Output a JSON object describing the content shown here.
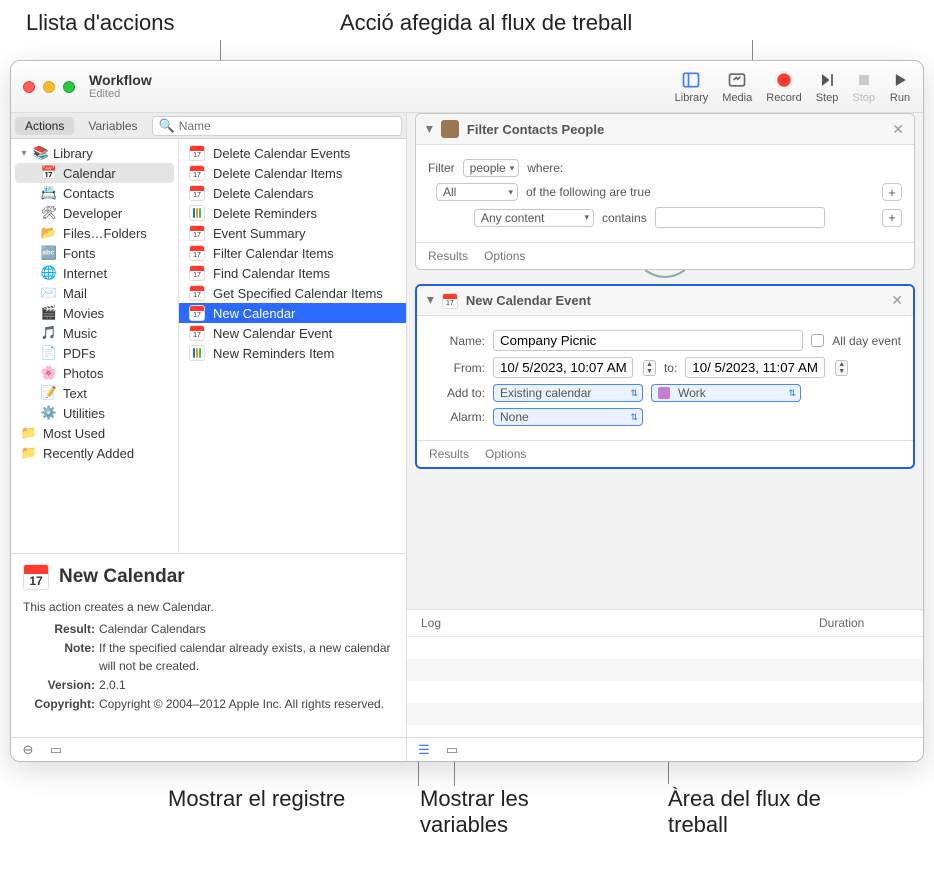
{
  "callouts": {
    "actions_list": "Llista d'accions",
    "added_action": "Acció afegida al flux de treball",
    "show_log": "Mostrar el registre",
    "show_vars": "Mostrar les variables",
    "workflow_area": "Àrea del flux de treball"
  },
  "window": {
    "title": "Workflow",
    "subtitle": "Edited"
  },
  "toolbar": {
    "library": "Library",
    "media": "Media",
    "record": "Record",
    "step": "Step",
    "stop": "Stop",
    "run": "Run"
  },
  "tabs": {
    "actions": "Actions",
    "variables": "Variables"
  },
  "search": {
    "placeholder": "Name"
  },
  "libraryHeader": "Library",
  "categories": [
    {
      "label": "Calendar",
      "sel": true
    },
    {
      "label": "Contacts"
    },
    {
      "label": "Developer"
    },
    {
      "label": "Files…Folders"
    },
    {
      "label": "Fonts"
    },
    {
      "label": "Internet"
    },
    {
      "label": "Mail"
    },
    {
      "label": "Movies"
    },
    {
      "label": "Music"
    },
    {
      "label": "PDFs"
    },
    {
      "label": "Photos"
    },
    {
      "label": "Text"
    },
    {
      "label": "Utilities"
    }
  ],
  "metaCats": [
    "Most Used",
    "Recently Added"
  ],
  "actions": [
    {
      "label": "Delete Calendar Events",
      "icon": "cal"
    },
    {
      "label": "Delete Calendar Items",
      "icon": "cal"
    },
    {
      "label": "Delete Calendars",
      "icon": "cal"
    },
    {
      "label": "Delete Reminders",
      "icon": "rem"
    },
    {
      "label": "Event Summary",
      "icon": "cal"
    },
    {
      "label": "Filter Calendar Items",
      "icon": "cal"
    },
    {
      "label": "Find Calendar Items",
      "icon": "cal"
    },
    {
      "label": "Get Specified Calendar Items",
      "icon": "cal"
    },
    {
      "label": "New Calendar",
      "icon": "cal",
      "sel": true
    },
    {
      "label": "New Calendar Event",
      "icon": "cal"
    },
    {
      "label": "New Reminders Item",
      "icon": "rem"
    }
  ],
  "desc": {
    "title": "New Calendar",
    "body": "This action creates a new Calendar.",
    "resultLabel": "Result:",
    "result": "Calendar Calendars",
    "noteLabel": "Note:",
    "note": "If the specified calendar already exists, a new calendar will not be created.",
    "versionLabel": "Version:",
    "version": "2.0.1",
    "copyrightLabel": "Copyright:",
    "copyright": "Copyright © 2004–2012 Apple Inc.  All rights reserved."
  },
  "wf1": {
    "title": "Filter Contacts People",
    "filter_lbl": "Filter",
    "filter_val": "people",
    "where": "where:",
    "all": "All",
    "following": "of the following are true",
    "anycontent": "Any content",
    "contains": "contains",
    "results": "Results",
    "options": "Options"
  },
  "wf2": {
    "title": "New Calendar Event",
    "name_lbl": "Name:",
    "name_val": "Company Picnic",
    "allday": "All day event",
    "from_lbl": "From:",
    "from_val": "10/ 5/2023, 10:07 AM",
    "to_lbl": "to:",
    "to_val": "10/ 5/2023, 11:07 AM",
    "addto_lbl": "Add to:",
    "addto_val": "Existing calendar",
    "work": "Work",
    "alarm_lbl": "Alarm:",
    "alarm_val": "None",
    "results": "Results",
    "options": "Options"
  },
  "log": {
    "col1": "Log",
    "col2": "Duration"
  }
}
